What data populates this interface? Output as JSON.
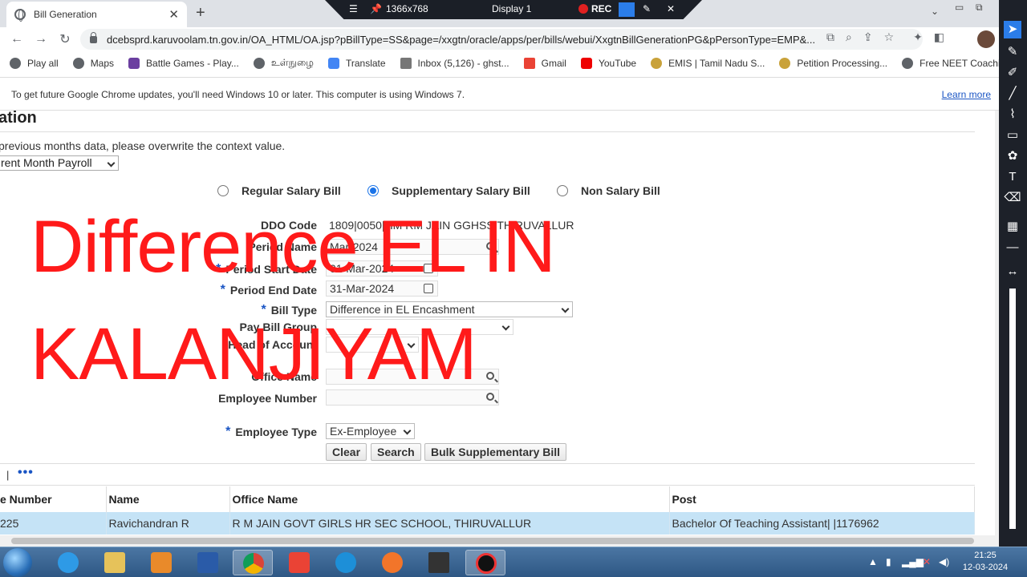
{
  "browser": {
    "tab_title": "Bill Generation",
    "url": "dcebsprd.karuvoolam.tn.gov.in/OA_HTML/OA.jsp?pBillType=SS&page=/xxgtn/oracle/apps/per/bills/webui/XxgtnBillGenerationPG&pPersonType=EMP&...",
    "bookmarks": [
      "Play all",
      "Maps",
      "Battle Games - Play...",
      "உள்நுழை",
      "Translate",
      "Inbox (5,126) - ghst...",
      "Gmail",
      "YouTube",
      "EMIS | Tamil Nadu S...",
      "Petition Processing...",
      "Free NEET Coachin..."
    ],
    "infobar_message": "To get future Google Chrome updates, you'll need Windows 10 or later. This computer is using Windows 7.",
    "infobar_link": "Learn more"
  },
  "recorder": {
    "resolution": "1366x768",
    "display": "Display 1",
    "rec": "REC"
  },
  "page": {
    "title_fragment": "ation",
    "hint": "previous months data, please overwrite the context value.",
    "context_value": "rent Month Payroll"
  },
  "bill_types": {
    "regular": "Regular Salary Bill",
    "supplementary": "Supplementary Salary Bill",
    "non_salary": "Non Salary Bill",
    "selected": "supplementary"
  },
  "form": {
    "ddo_code_label": "DDO Code",
    "ddo_code_value": "1809|0050|HM RM JAIN GGHSS THIRUVALLUR",
    "period_name_label": "Period Name",
    "period_name_value": "Mar-2024",
    "period_start_label": "Period Start Date",
    "period_start_value": "01-Mar-2024",
    "period_end_label": "Period End Date",
    "period_end_value": "31-Mar-2024",
    "bill_type_label": "Bill Type",
    "bill_type_value": "Difference in EL Encashment",
    "pay_bill_group_label": "Pay Bill Group",
    "head_of_account_label": "Head of Account",
    "office_name_label": "Office Name",
    "employee_number_label": "Employee Number",
    "employee_type_label": "Employee Type",
    "employee_type_value": "Ex-Employee",
    "required_mark": "*"
  },
  "buttons": {
    "clear": "Clear",
    "search": "Search",
    "bulk": "Bulk Supplementary Bill"
  },
  "table": {
    "separator": "|",
    "more": "•••",
    "columns": [
      "e Number",
      "Name",
      "Office Name",
      "Post"
    ],
    "rows": [
      [
        "225",
        "Ravichandran R",
        "R M JAIN GOVT GIRLS HR SEC SCHOOL, THIRUVALLUR",
        "Bachelor Of Teaching Assistant| |1176962"
      ]
    ]
  },
  "overlay": {
    "line1": "Difference EL IN",
    "line2": "KALANJIYAM"
  },
  "taskbar": {
    "time": "21:25",
    "date": "12-03-2024"
  }
}
